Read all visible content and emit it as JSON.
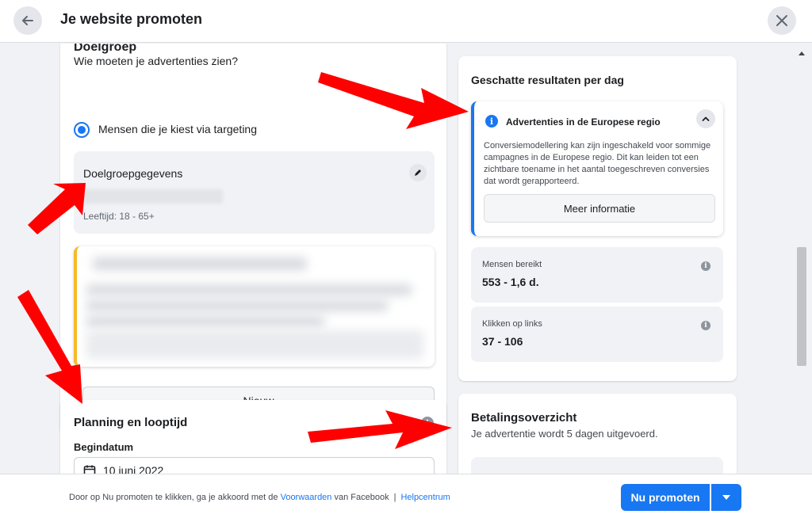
{
  "header": {
    "title": "Je website promoten",
    "back_icon": "arrow-left-icon",
    "close_icon": "close-icon"
  },
  "audience": {
    "heading": "Doelgroep",
    "subheading": "Wie moeten je advertenties zien?",
    "radio_label": "Mensen die je kiest via targeting",
    "details_title": "Doelgroepgegevens",
    "age": "Leeftijd: 18 - 65+",
    "new_button": "Nieuw"
  },
  "schedule": {
    "heading": "Planning en looptijd",
    "start_label": "Begindatum",
    "start_value": "10 juni 2022"
  },
  "results": {
    "heading": "Geschatte resultaten per dag",
    "eu_title": "Advertenties in de Europese regio",
    "eu_text": "Conversiemodellering kan zijn ingeschakeld voor sommige campagnes in de Europese regio. Dit kan leiden tot een zichtbare toename in het aantal toegeschreven conversies dat wordt gerapporteerd.",
    "more_button": "Meer informatie",
    "reach_label": "Mensen bereikt",
    "reach_value": "553 - 1,6 d.",
    "clicks_label": "Klikken op links",
    "clicks_value": "37 - 106"
  },
  "payment": {
    "heading": "Betalingsoverzicht",
    "subheading": "Je advertentie wordt 5 dagen uitgevoerd."
  },
  "footer": {
    "text_before": "Door op Nu promoten te klikken, ga je akkoord met de ",
    "terms_link": "Voorwaarden",
    "text_after": " van Facebook",
    "separator": "|",
    "help_link": "Helpcentrum",
    "promote_button": "Nu promoten"
  },
  "colors": {
    "accent": "#1877f2",
    "warning": "#f7b928",
    "annotation_arrow": "#ff0000"
  }
}
